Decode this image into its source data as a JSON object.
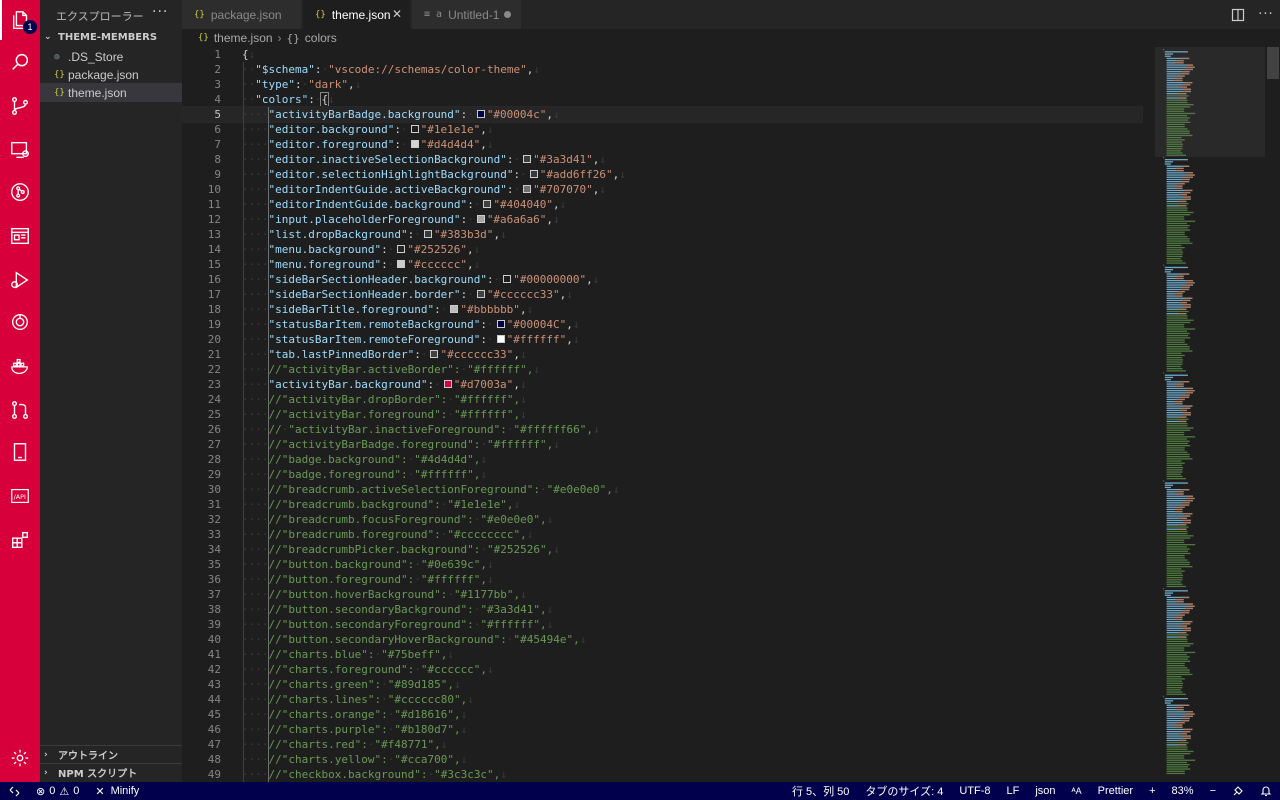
{
  "activity_bar": {
    "explorer_badge": "1",
    "items": [
      "files-icon",
      "search-icon",
      "source-control-icon",
      "remote-explorer-icon",
      "git-graph-icon",
      "preview-icon",
      "run-debug-icon",
      "remote-icon",
      "docker-icon",
      "pull-request-icon",
      "device-icon",
      "api-icon",
      "extensions-icon"
    ]
  },
  "sidebar": {
    "title": "エクスプローラー",
    "more": "···",
    "section_title": "THEME-MEMBERS",
    "files": [
      {
        "name": ".DS_Store",
        "icon": "ds-file-icon"
      },
      {
        "name": "package.json",
        "icon": "json-file-icon"
      },
      {
        "name": "theme.json",
        "icon": "json-file-icon",
        "selected": true
      }
    ],
    "outline": "アウトライン",
    "npm_scripts": "NPM スクリプト"
  },
  "tabs": [
    {
      "label": "package.json",
      "icon": "{}"
    },
    {
      "label": "theme.json",
      "icon": "{}",
      "active": true
    },
    {
      "label": "Untitled-1",
      "icon": "≡ a",
      "dirty": true
    }
  ],
  "breadcrumb": {
    "file": "theme.json",
    "symbol": "colors"
  },
  "editor": {
    "current_line": 5,
    "lines": [
      {
        "n": "1",
        "t": "{"
      },
      {
        "n": "2",
        "t": "  \"$schema\": \"vscode://schemas/color-theme\","
      },
      {
        "n": "3",
        "t": "  \"type\": \"dark\","
      },
      {
        "n": "4",
        "t": "  \"colors\": {"
      },
      {
        "n": "5",
        "t": "    \"activityBarBadge.background\": \"#00004c\",",
        "c": "#00004c"
      },
      {
        "n": "6",
        "t": "    \"editor.background\": \"#1e1e1e\",",
        "c": "#1e1e1e"
      },
      {
        "n": "7",
        "t": "    \"editor.foreground\": \"#d4d4d4\",",
        "c": "#d4d4d4"
      },
      {
        "n": "8",
        "t": "    \"editor.inactiveSelectionBackground\": \"#3a3d41\",",
        "c": "#3a3d41"
      },
      {
        "n": "9",
        "t": "    \"editor.selectionHighlightBackground\": \"#add6ff26\",",
        "c": "#add6ff26"
      },
      {
        "n": "10",
        "t": "    \"editorIndentGuide.activeBackground\": \"#707070\",",
        "c": "#707070"
      },
      {
        "n": "11",
        "t": "    \"editorIndentGuide.background\": \"#404040\",",
        "c": "#404040"
      },
      {
        "n": "12",
        "t": "    \"input.placeholderForeground\": \"#a6a6a6\",",
        "c": "#a6a6a6"
      },
      {
        "n": "13",
        "t": "    \"list.dropBackground\": \"#383b3d\",",
        "c": "#383b3d"
      },
      {
        "n": "14",
        "t": "    \"menu.background\": \"#252526\",",
        "c": "#252526"
      },
      {
        "n": "15",
        "t": "    \"menu.foreground\": \"#cccccc\",",
        "c": "#cccccc"
      },
      {
        "n": "16",
        "t": "    \"sideBarSectionHeader.background\": \"#00000000\",",
        "c": "#00000000"
      },
      {
        "n": "17",
        "t": "    \"sideBarSectionHeader.border\": \"#cccccc33\",",
        "c": "#cccccc33"
      },
      {
        "n": "18",
        "t": "    \"sideBarTitle.foreground\": \"#bbbbbb\",",
        "c": "#bbbbbb"
      },
      {
        "n": "19",
        "t": "    \"statusBarItem.remoteBackground\": \"#00004C\",",
        "c": "#00004C"
      },
      {
        "n": "20",
        "t": "    \"statusBarItem.remoteForeground\": \"#ffffff\",",
        "c": "#ffffff"
      },
      {
        "n": "21",
        "t": "    \"tab.lastPinnedBorder\": \"#cccccc33\",",
        "c": "#cccccc33"
      },
      {
        "n": "22",
        "t": "    //\"activityBar.activeBorder\": \"#ffffff\","
      },
      {
        "n": "23",
        "t": "    \"activityBar.background\": \"#d7003a\",",
        "c": "#d7003a"
      },
      {
        "n": "24",
        "t": "    //\"activityBar.dropBorder\": \"#ffffff\","
      },
      {
        "n": "25",
        "t": "    //\"activityBar.foreground\": \"#ffffff\","
      },
      {
        "n": "26",
        "t": "    // \"activityBar.inactiveForeground\": \"#ffffff66\","
      },
      {
        "n": "27",
        "t": "    //\"activityBarBadge.foreground\": \"#ffffff\","
      },
      {
        "n": "28",
        "t": "    //\"badge.background\": \"#4d4d4d\","
      },
      {
        "n": "29",
        "t": "    //\"badge.foreground\": \"#ffffff\","
      },
      {
        "n": "30",
        "t": "    //\"breadcrumb.activeSelectionForeground\": \"#e0e0e0\","
      },
      {
        "n": "31",
        "t": "    //\"breadcrumb.background\": \"#1e1e1e\","
      },
      {
        "n": "32",
        "t": "    //\"breadcrumb.focusForeground\": \"#e0e0e0\","
      },
      {
        "n": "33",
        "t": "    //\"breadcrumb.foreground\": \"#cccccccc\","
      },
      {
        "n": "34",
        "t": "    //\"breadcrumbPicker.background\": \"#252526\","
      },
      {
        "n": "35",
        "t": "    //\"button.background\": \"#0e639c\","
      },
      {
        "n": "36",
        "t": "    //\"button.foreground\": \"#ffffff\","
      },
      {
        "n": "37",
        "t": "    //\"button.hoverBackground\": \"#1177bb\","
      },
      {
        "n": "38",
        "t": "    //\"button.secondaryBackground\": \"#3a3d41\","
      },
      {
        "n": "39",
        "t": "    //\"button.secondaryForeground\": \"#ffffff\","
      },
      {
        "n": "40",
        "t": "    //\"button.secondaryHoverBackground\": \"#45494e\","
      },
      {
        "n": "41",
        "t": "    //\"charts.blue\": \"#75beff\","
      },
      {
        "n": "42",
        "t": "    //\"charts.foreground\": \"#cccccc\","
      },
      {
        "n": "43",
        "t": "    //\"charts.green\": \"#89d185\","
      },
      {
        "n": "44",
        "t": "    //\"charts.lines\": \"#cccccc80\","
      },
      {
        "n": "45",
        "t": "    //\"charts.orange\": \"#d18616\","
      },
      {
        "n": "46",
        "t": "    //\"charts.purple\": \"#b180d7\","
      },
      {
        "n": "47",
        "t": "    //\"charts.red\": \"#f48771\","
      },
      {
        "n": "48",
        "t": "    //\"charts.yellow\": \"#cca700\","
      },
      {
        "n": "49",
        "t": "    //\"checkbox.background\": \"#3c3c3c\","
      }
    ]
  },
  "status_bar": {
    "problems_errors": "0",
    "problems_warnings": "0",
    "minify": "Minify",
    "cursor": "行 5、列 50",
    "tab_size": "タブのサイズ: 4",
    "encoding": "UTF-8",
    "eol": "LF",
    "language": "json",
    "font_size_icon": "ᴬA",
    "prettier": "Prettier",
    "plus": "+",
    "zoom": "83%"
  },
  "colors": {
    "activity_bar": "#d7003a",
    "status_bar": "#00004c",
    "key": "#9cdcfe",
    "string": "#ce9178",
    "comment": "#6a9955"
  }
}
